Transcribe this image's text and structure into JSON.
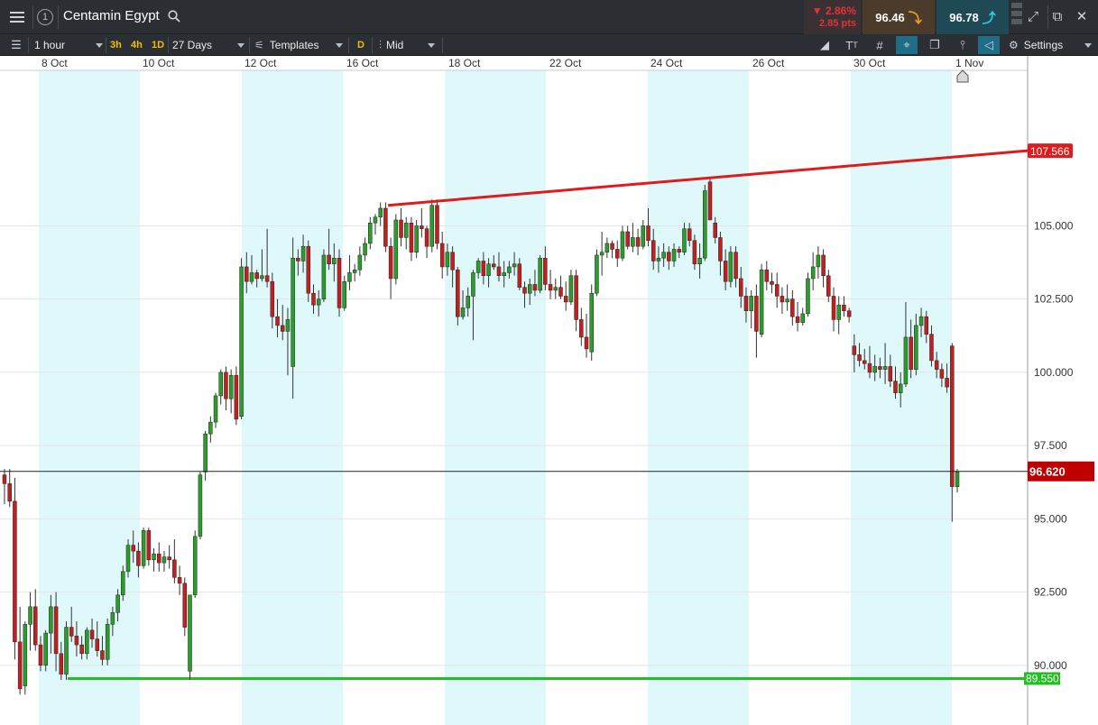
{
  "window": {
    "number": "1",
    "instrument": "Centamin Egypt",
    "change_pct": "▼ 2.86%",
    "change_pts": "2.85 pts",
    "sell_price": "96.46",
    "buy_price": "96.78"
  },
  "toolbar": {
    "interval": "1 hour",
    "quick_3h": "3h",
    "quick_4h": "4h",
    "quick_1d": "1D",
    "range": "27 Days",
    "templates_label": "Templates",
    "d_chip": "D",
    "price_type": "Mid",
    "settings_label": "Settings"
  },
  "colors": {
    "up_candle": "#2a9d2a",
    "down_candle": "#c22020",
    "weekend_band": "#dff9fb",
    "resistance": "#e01b1b",
    "support": "#1fc01f",
    "current_price_tag": "#c00000"
  },
  "chart_data": {
    "type": "candlestick",
    "x_tick_labels": [
      "8 Oct",
      "10 Oct",
      "12 Oct",
      "16 Oct",
      "18 Oct",
      "22 Oct",
      "24 Oct",
      "26 Oct",
      "30 Oct",
      "1 Nov"
    ],
    "y_tick_labels": [
      "105.000",
      "102.500",
      "100.000",
      "97.500",
      "95.000",
      "92.500",
      "90.000"
    ],
    "y_ticks": [
      105,
      102.5,
      100,
      97.5,
      95,
      92.5,
      90
    ],
    "ylim": [
      88.3,
      110.4
    ],
    "current_price": 96.62,
    "current_price_label": "96.620",
    "resistance_label": "107.566",
    "support_label": "89.550",
    "resistance_line": {
      "from": 105.7,
      "to": 107.566
    },
    "support_line": 89.55,
    "candles": [
      [
        96.5,
        96.7,
        95.5,
        96.2
      ],
      [
        96.2,
        96.7,
        95.4,
        95.6
      ],
      [
        95.6,
        96.4,
        90.2,
        90.8
      ],
      [
        90.8,
        92,
        89,
        89.2
      ],
      [
        89.3,
        91.5,
        89,
        91.4
      ],
      [
        91.4,
        92.5,
        90.5,
        92.0
      ],
      [
        92.0,
        92.6,
        90.5,
        90.7
      ],
      [
        90.7,
        91,
        89.8,
        90.0
      ],
      [
        90.0,
        91.2,
        89.8,
        91.1
      ],
      [
        91.1,
        92.4,
        90.4,
        92.0
      ],
      [
        92.0,
        92.5,
        89.8,
        90.4
      ],
      [
        90.4,
        90.8,
        89.5,
        89.7
      ],
      [
        89.7,
        91.5,
        89.5,
        91.3
      ],
      [
        91.3,
        92,
        90.8,
        91.0
      ],
      [
        91.0,
        91.5,
        90.3,
        90.7
      ],
      [
        90.7,
        91,
        90.2,
        90.4
      ],
      [
        90.4,
        91.3,
        90.2,
        91.2
      ],
      [
        91.2,
        91.6,
        90.6,
        90.9
      ],
      [
        90.9,
        91.5,
        90.3,
        90.5
      ],
      [
        90.5,
        91,
        90.0,
        90.2
      ],
      [
        90.2,
        91.6,
        90.0,
        91.4
      ],
      [
        91.4,
        92,
        91,
        91.8
      ],
      [
        91.8,
        92.6,
        91.5,
        92.4
      ],
      [
        92.4,
        93.4,
        92.2,
        93.2
      ],
      [
        93.2,
        94.3,
        93,
        94.1
      ],
      [
        94.1,
        94.6,
        93.5,
        93.9
      ],
      [
        93.9,
        94.2,
        93,
        93.4
      ],
      [
        93.4,
        94.7,
        93.3,
        94.6
      ],
      [
        94.6,
        94.7,
        93.4,
        93.6
      ],
      [
        93.6,
        94.0,
        93.2,
        93.8
      ],
      [
        93.8,
        94.2,
        93.2,
        93.5
      ],
      [
        93.5,
        93.9,
        93.2,
        93.7
      ],
      [
        93.7,
        94.1,
        93.3,
        93.6
      ],
      [
        93.6,
        94.3,
        92.8,
        93.0
      ],
      [
        93.0,
        93.4,
        92.4,
        92.8
      ],
      [
        92.8,
        93.0,
        91.0,
        91.3
      ],
      [
        89.8,
        92.4,
        89.5,
        92.4
      ],
      [
        92.4,
        94.6,
        92.3,
        94.4
      ],
      [
        94.4,
        96.6,
        94.3,
        96.5
      ],
      [
        96.6,
        98.0,
        96.3,
        97.9
      ],
      [
        97.9,
        98.5,
        97.6,
        98.3
      ],
      [
        98.3,
        99.3,
        98.1,
        99.2
      ],
      [
        99.2,
        100.1,
        98.9,
        100.0
      ],
      [
        100.0,
        100.2,
        98.7,
        99.1
      ],
      [
        99.1,
        100.1,
        98.6,
        99.9
      ],
      [
        99.9,
        100.2,
        98.2,
        98.4
      ],
      [
        98.5,
        103.9,
        98.4,
        103.6
      ],
      [
        103.6,
        104.1,
        102.7,
        103.1
      ],
      [
        103.1,
        104,
        103,
        103.4
      ],
      [
        103.4,
        103.5,
        102.9,
        103.2
      ],
      [
        103.2,
        104.2,
        103.1,
        103.3
      ],
      [
        103.3,
        104.9,
        102.9,
        103.1
      ],
      [
        103.1,
        103.4,
        101.5,
        101.9
      ],
      [
        101.9,
        102.5,
        101.2,
        101.6
      ],
      [
        101.6,
        102.3,
        101.1,
        101.4
      ],
      [
        101.4,
        102.2,
        99.9,
        101.8
      ],
      [
        100.2,
        104.6,
        99.1,
        103.9
      ],
      [
        103.9,
        104.2,
        103.3,
        103.8
      ],
      [
        103.8,
        104.7,
        103.4,
        104.3
      ],
      [
        104.3,
        104.5,
        102.4,
        102.7
      ],
      [
        102.7,
        103,
        102,
        102.3
      ],
      [
        102.3,
        102.8,
        101.9,
        102.5
      ],
      [
        102.5,
        104.2,
        102.4,
        104.0
      ],
      [
        104.0,
        104.9,
        103.5,
        103.7
      ],
      [
        103.7,
        104.4,
        103.1,
        103.9
      ],
      [
        103.9,
        104.2,
        101.9,
        102.2
      ],
      [
        102.2,
        103.3,
        102.1,
        103.1
      ],
      [
        103.1,
        104.0,
        102.8,
        103.4
      ],
      [
        103.4,
        103.7,
        103.1,
        103.5
      ],
      [
        103.5,
        104.3,
        103.3,
        104.0
      ],
      [
        104.0,
        104.6,
        103.8,
        104.4
      ],
      [
        104.4,
        105.3,
        104.2,
        105.1
      ],
      [
        105.1,
        105.4,
        104.7,
        105.3
      ],
      [
        105.3,
        105.8,
        105.0,
        105.6
      ],
      [
        105.6,
        105.8,
        104.1,
        104.3
      ],
      [
        104.3,
        104.6,
        102.5,
        103.2
      ],
      [
        103.2,
        105.4,
        103,
        105.2
      ],
      [
        105.2,
        105.6,
        104.3,
        104.6
      ],
      [
        104.6,
        105.3,
        104.2,
        105.1
      ],
      [
        105.1,
        105.3,
        103.8,
        104.1
      ],
      [
        104.1,
        105.2,
        103.9,
        105.0
      ],
      [
        105.0,
        105.6,
        104.6,
        104.9
      ],
      [
        104.9,
        105,
        103.9,
        104.3
      ],
      [
        104.3,
        105.9,
        104.1,
        105.7
      ],
      [
        105.7,
        105.9,
        104.2,
        104.4
      ],
      [
        104.4,
        104.8,
        103.2,
        103.6
      ],
      [
        103.6,
        104.4,
        103.3,
        104.1
      ],
      [
        104.1,
        104.3,
        102.9,
        103.5
      ],
      [
        103.5,
        103.6,
        101.6,
        101.9
      ],
      [
        101.9,
        102.8,
        101.8,
        102.2
      ],
      [
        102.2,
        102.9,
        101.9,
        102.6
      ],
      [
        102.6,
        103.5,
        101.1,
        103.4
      ],
      [
        103.4,
        103.9,
        103.2,
        103.8
      ],
      [
        103.8,
        104.1,
        103.0,
        103.3
      ],
      [
        103.3,
        103.9,
        102.9,
        103.7
      ],
      [
        103.7,
        104.0,
        103.5,
        103.6
      ],
      [
        103.6,
        104.1,
        103.1,
        103.3
      ],
      [
        103.3,
        103.8,
        102.9,
        103.4
      ],
      [
        103.4,
        103.8,
        103.2,
        103.6
      ],
      [
        103.6,
        104.1,
        103.3,
        103.7
      ],
      [
        103.7,
        103.9,
        102.8,
        102.9
      ],
      [
        102.9,
        103.1,
        102.2,
        102.7
      ],
      [
        102.7,
        103.2,
        102.3,
        103.0
      ],
      [
        103.0,
        103.5,
        102.6,
        102.8
      ],
      [
        102.8,
        104.0,
        102.7,
        103.9
      ],
      [
        103.9,
        104.3,
        102.8,
        103.0
      ],
      [
        103.0,
        103.5,
        102.5,
        102.8
      ],
      [
        102.8,
        103.2,
        102.5,
        102.9
      ],
      [
        102.9,
        103.3,
        102.5,
        102.6
      ],
      [
        102.6,
        103.1,
        102.1,
        102.4
      ],
      [
        102.4,
        103.5,
        102.3,
        103.3
      ],
      [
        103.3,
        103.5,
        101.4,
        101.8
      ],
      [
        101.8,
        102.2,
        100.9,
        101.2
      ],
      [
        101.2,
        102.0,
        100.5,
        100.8
      ],
      [
        100.7,
        103.0,
        100.4,
        102.7
      ],
      [
        102.7,
        104.2,
        102.6,
        104.0
      ],
      [
        104.0,
        104.8,
        103.3,
        104.1
      ],
      [
        104.1,
        104.6,
        103.9,
        104.4
      ],
      [
        104.4,
        104.5,
        103.9,
        104.2
      ],
      [
        104.2,
        104.5,
        103.6,
        103.9
      ],
      [
        103.9,
        105.0,
        103.8,
        104.8
      ],
      [
        104.8,
        105.0,
        104.2,
        104.3
      ],
      [
        104.3,
        105.1,
        104.1,
        104.6
      ],
      [
        104.6,
        104.9,
        104.0,
        104.3
      ],
      [
        104.3,
        105.2,
        104.2,
        105.0
      ],
      [
        105.0,
        105.6,
        104.3,
        104.5
      ],
      [
        104.5,
        104.9,
        103.5,
        103.8
      ],
      [
        103.8,
        104.3,
        103.4,
        103.9
      ],
      [
        103.9,
        104.4,
        103.6,
        104.1
      ],
      [
        104.1,
        104.3,
        103.5,
        103.8
      ],
      [
        103.8,
        104.4,
        103.6,
        104.2
      ],
      [
        104.2,
        104.3,
        103.9,
        104.1
      ],
      [
        104.1,
        105.1,
        104.0,
        104.9
      ],
      [
        104.9,
        105.1,
        104.3,
        104.5
      ],
      [
        104.5,
        104.7,
        103.5,
        103.7
      ],
      [
        103.7,
        104.4,
        103.2,
        103.9
      ],
      [
        103.9,
        106.4,
        103.8,
        106.2
      ],
      [
        106.5,
        106.6,
        105.3,
        105.2
      ],
      [
        105.1,
        105.3,
        104.4,
        104.6
      ],
      [
        104.6,
        104.8,
        103.3,
        103.8
      ],
      [
        103.8,
        104.2,
        102.8,
        103.1
      ],
      [
        103.1,
        104.3,
        102.9,
        104.1
      ],
      [
        104.1,
        104.3,
        102.9,
        103.2
      ],
      [
        103.2,
        103.6,
        102.2,
        102.6
      ],
      [
        102.6,
        102.9,
        101.7,
        102.1
      ],
      [
        102.1,
        102.8,
        101.5,
        102.6
      ],
      [
        102.6,
        103.0,
        100.5,
        101.4
      ],
      [
        101.3,
        103.7,
        101.2,
        103.5
      ],
      [
        103.5,
        103.8,
        102.8,
        103.1
      ],
      [
        103.1,
        103.4,
        102.7,
        103.0
      ],
      [
        103.0,
        103.4,
        102.2,
        102.6
      ],
      [
        102.6,
        102.9,
        102.0,
        102.4
      ],
      [
        102.4,
        103.0,
        102.1,
        102.5
      ],
      [
        102.5,
        102.8,
        101.6,
        101.9
      ],
      [
        101.9,
        102.4,
        101.4,
        101.7
      ],
      [
        101.7,
        102.2,
        101.6,
        102.0
      ],
      [
        102.0,
        103.4,
        101.9,
        103.2
      ],
      [
        103.2,
        104.1,
        102.8,
        103.6
      ],
      [
        103.6,
        104.3,
        103.2,
        104.0
      ],
      [
        104.0,
        104.2,
        102.9,
        103.3
      ],
      [
        103.3,
        103.5,
        102.4,
        102.6
      ],
      [
        102.6,
        102.9,
        101.4,
        101.8
      ],
      [
        101.8,
        102.6,
        101.3,
        102.3
      ],
      [
        102.3,
        102.6,
        101.9,
        102.1
      ],
      [
        102.1,
        102.2,
        101.7,
        101.9
      ],
      [
        100.9,
        101.3,
        100.0,
        100.6
      ],
      [
        100.6,
        101,
        100.2,
        100.4
      ],
      [
        100.4,
        100.8,
        100.1,
        100.3
      ],
      [
        100.3,
        100.9,
        99.8,
        100.0
      ],
      [
        100.0,
        100.6,
        99.7,
        100.2
      ],
      [
        100.2,
        100.5,
        99.8,
        100.1
      ],
      [
        100.1,
        101,
        99.6,
        100.2
      ],
      [
        100.2,
        100.6,
        99.5,
        99.7
      ],
      [
        99.7,
        100.2,
        99.1,
        99.3
      ],
      [
        99.3,
        100.0,
        98.8,
        99.6
      ],
      [
        99.6,
        102.4,
        99.5,
        101.2
      ],
      [
        101.2,
        101.8,
        99.8,
        100.1
      ],
      [
        100.1,
        102.0,
        99.9,
        101.6
      ],
      [
        101.6,
        102.2,
        101.2,
        101.9
      ],
      [
        101.9,
        102.1,
        101.0,
        101.3
      ],
      [
        101.3,
        101.6,
        100.2,
        100.4
      ],
      [
        100.4,
        100.7,
        99.8,
        100.1
      ],
      [
        100.1,
        100.3,
        99.5,
        99.8
      ],
      [
        99.8,
        100.3,
        99.3,
        99.5
      ],
      [
        100.9,
        101.0,
        94.9,
        96.1
      ],
      [
        96.1,
        96.7,
        95.9,
        96.6
      ]
    ]
  }
}
